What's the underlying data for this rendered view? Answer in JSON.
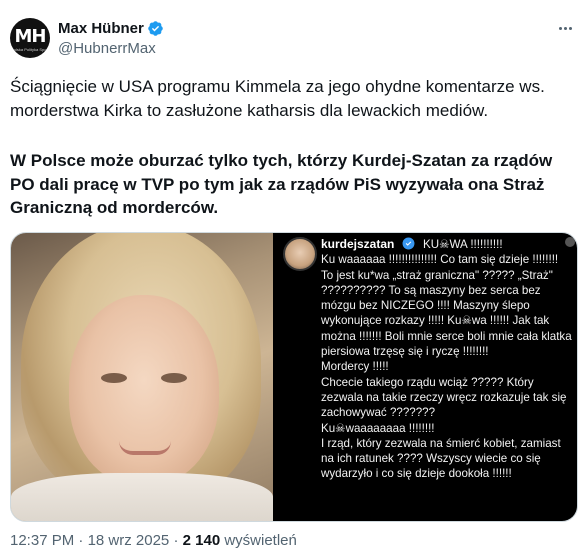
{
  "author": {
    "display_name": "Max Hübner",
    "handle": "@HubnerrMax",
    "avatar_initials": "MH",
    "avatar_subtitle": "Polska Polityka Sport"
  },
  "tweet": {
    "paragraph_1": "Ściągnięcie w USA programu Kimmela za jego ohydne komentarze ws. morderstwa Kirka to zasłużone katharsis dla lewackich mediów.",
    "paragraph_2": "W Polsce może oburzać tylko tych, którzy Kurdej-Szatan za rządów PO dali pracę w TVP po tym jak za rządów PiS wyzywała ona Straż Graniczną od morderców."
  },
  "media": {
    "story_username": "kurdejszatan",
    "story_lines": [
      "KU☠WA !!!!!!!!!!",
      "Ku waaaaaa !!!!!!!!!!!!!!! Co tam się dzieje !!!!!!!! To jest ku*wa „straż graniczna\" ????? „Straż\" ?????????? To są maszyny bez serca bez mózgu bez NICZEGO !!!! Maszyny ślepo wykonujące rozkazy !!!!! Ku☠wa !!!!!! Jak tak można !!!!!!! Boli mnie serce boli mnie cała klatka piersiowa trzęsę się i ryczę !!!!!!!!",
      "Mordercy !!!!!",
      "Chcecie takiego rządu wciąż ????? Który zezwala na takie rzeczy wręcz rozkazuje tak się zachowywać ???????",
      "Ku☠waaaaaaaa !!!!!!!!",
      "I rząd, który zezwala na śmierć kobiet, zamiast na ich ratunek ???? Wszyscy wiecie co się wydarzyło i co się dzieje dookoła !!!!!!"
    ]
  },
  "footer": {
    "time": "12:37 PM",
    "separator": "·",
    "date": "18 wrz 2025",
    "views_count": "2 140",
    "views_label": "wyświetleń"
  },
  "colors": {
    "text": "#0f1419",
    "secondary": "#536471",
    "verified": "#1d9bf0"
  }
}
